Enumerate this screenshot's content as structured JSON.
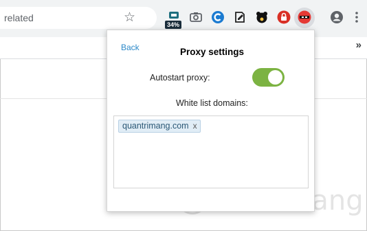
{
  "browser": {
    "omnibox_text": "related",
    "badge_text": "34%",
    "bookmarks_overflow": "»"
  },
  "popup": {
    "back_label": "Back",
    "title": "Proxy settings",
    "autostart_label": "Autostart proxy:",
    "autostart_enabled": true,
    "whitelist_label": "White list domains:",
    "domains": [
      "quantrimang.com"
    ],
    "tag_remove": "x"
  },
  "watermark": {
    "text": "uantrimang"
  },
  "colors": {
    "toggle_on": "#7cb342",
    "link": "#2b88c8",
    "tag_bg": "#e1edf6"
  },
  "icons": [
    "bookmark-star-icon",
    "extension-vpn-icon",
    "camera-icon",
    "ccleaner-icon",
    "notes-icon",
    "bear-icon",
    "lock-icon",
    "proxy-ninja-icon",
    "account-icon",
    "more-menu-icon"
  ]
}
